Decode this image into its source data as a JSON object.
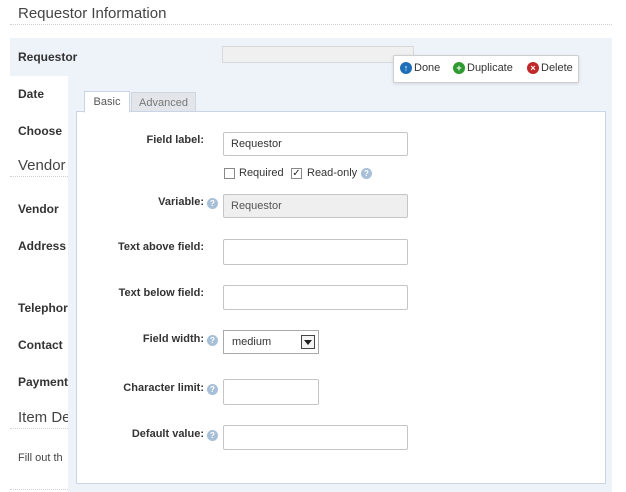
{
  "page": {
    "section_requestor": "Requestor Information",
    "section_vendor": "Vendor",
    "section_item": "Item De",
    "fill_text": "Fill out th",
    "labels": {
      "requestor": "Requestor",
      "date": "Date",
      "choose": "Choose",
      "vendor": "Vendor",
      "address": "Address",
      "telephone": "Telephor",
      "contact": "Contact",
      "payment": "Payment"
    }
  },
  "actions": {
    "done": "Done",
    "duplicate": "Duplicate",
    "delete": "Delete"
  },
  "editor": {
    "tabs": [
      "Basic",
      "Advanced"
    ],
    "field_label": {
      "label": "Field label:",
      "value": "Requestor"
    },
    "required": {
      "label": "Required",
      "checked": false
    },
    "readonly": {
      "label": "Read-only",
      "checked": true
    },
    "variable": {
      "label": "Variable:",
      "value": "Requestor"
    },
    "text_above": {
      "label": "Text above field:",
      "value": ""
    },
    "text_below": {
      "label": "Text below field:",
      "value": ""
    },
    "field_width": {
      "label": "Field width:",
      "value": "medium"
    },
    "char_limit": {
      "label": "Character limit:",
      "value": ""
    },
    "default_value": {
      "label": "Default value:",
      "value": ""
    },
    "help_glyph": "?"
  },
  "colors": {
    "done_icon": "#1f6fb8",
    "duplicate_icon": "#2f9a2f",
    "delete_icon": "#c0282a",
    "editor_bg": "#eef3fa"
  }
}
